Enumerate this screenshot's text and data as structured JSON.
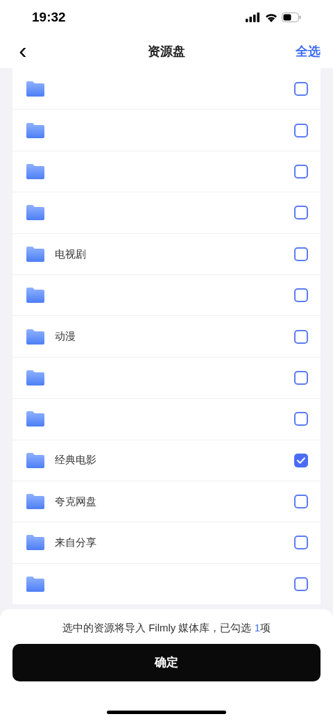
{
  "status_bar": {
    "time": "19:32"
  },
  "nav": {
    "back": "‹",
    "title": "资源盘",
    "action": "全选"
  },
  "folders": [
    {
      "checked": false
    },
    {
      "checked": false
    },
    {
      "checked": false
    },
    {
      "checked": false
    },
    {
      "name": "电视剧",
      "checked": false
    },
    {
      "checked": false
    },
    {
      "name": "动漫",
      "checked": false
    },
    {
      "checked": false
    },
    {
      "checked": false
    },
    {
      "name": "经典电影",
      "checked": true
    },
    {
      "name": "夸克网盘",
      "checked": false
    },
    {
      "name": "来自分享",
      "checked": false
    },
    {
      "checked": false
    }
  ],
  "footer": {
    "note_before": "选中的资源将导入 Filmly 媒体库，已勾选 ",
    "selected_count": "1",
    "note_after": "项",
    "confirm": "确定"
  }
}
